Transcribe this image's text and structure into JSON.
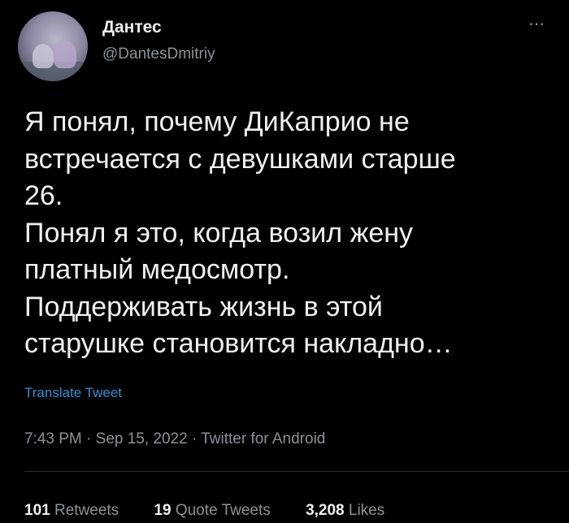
{
  "author": {
    "name": "Дантес",
    "handle": "@DantesDmitriy"
  },
  "more_icon": "⋯",
  "tweet": {
    "text": "Я понял, почему ДиКаприо не\nвстречается с девушками старше\n26.\nПонял я это, когда возил жену\nплатный медосмотр.\nПоддерживать жизнь в этой\nстарушке становится накладно…",
    "translate_label": "Translate Tweet",
    "meta": "7:43 PM · Sep 15, 2022 · Twitter for Android"
  },
  "stats": {
    "retweets_count": "101",
    "retweets_label": "Retweets",
    "quotes_count": "19",
    "quotes_label": "Quote Tweets",
    "likes_count": "3,208",
    "likes_label": "Likes"
  },
  "colors": {
    "background": "#000000",
    "text": "#eef0f1",
    "secondary": "#8b9299",
    "link": "#2f8fd6"
  }
}
